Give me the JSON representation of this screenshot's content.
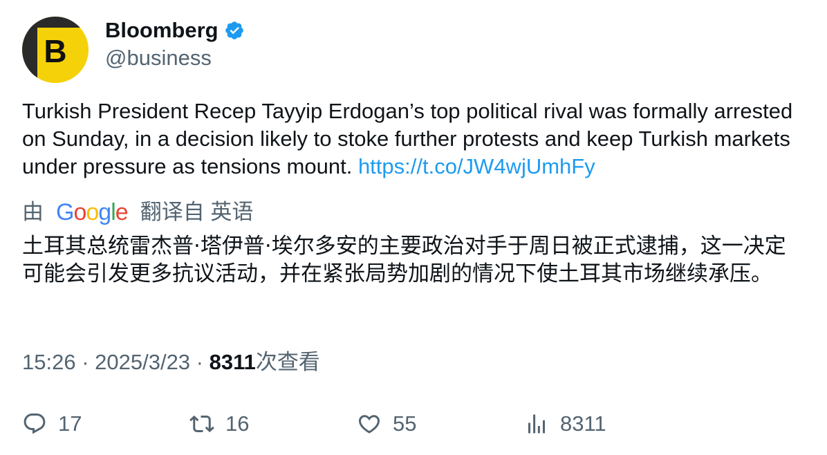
{
  "author": {
    "name": "Bloomberg",
    "handle": "@business",
    "avatar_letter": "B",
    "avatar_color": "#f5d10a",
    "verified": true,
    "verified_color": "#1d9bf0"
  },
  "tweet": {
    "text": "Turkish President Recep Tayyip Erdogan’s top political rival was formally arrested on Sunday, in a decision likely to stoke further protests and keep Turkish markets under pressure as tensions mount. ",
    "link": "https://t.co/JW4wjUmhFy"
  },
  "translation": {
    "by_label": "由",
    "provider": [
      "G",
      "o",
      "o",
      "g",
      "l",
      "e"
    ],
    "translated_from_label": "翻译自 英语",
    "text": "土耳其总统雷杰普·塔伊普·埃尔多安的主要政治对手于周日被正式逮捕，这一决定可能会引发更多抗议活动，并在紧张局势加剧的情况下使土耳其市场继续承压。"
  },
  "meta": {
    "time": "15:26",
    "sep1": " · ",
    "date": "2025/3/23",
    "sep2": " · ",
    "views": "8311",
    "views_label": "次查看"
  },
  "actions": {
    "reply": "17",
    "retweet": "16",
    "like": "55",
    "views": "8311"
  },
  "colors": {
    "text": "#0f1419",
    "secondary": "#536471",
    "link": "#1d9bf0"
  }
}
